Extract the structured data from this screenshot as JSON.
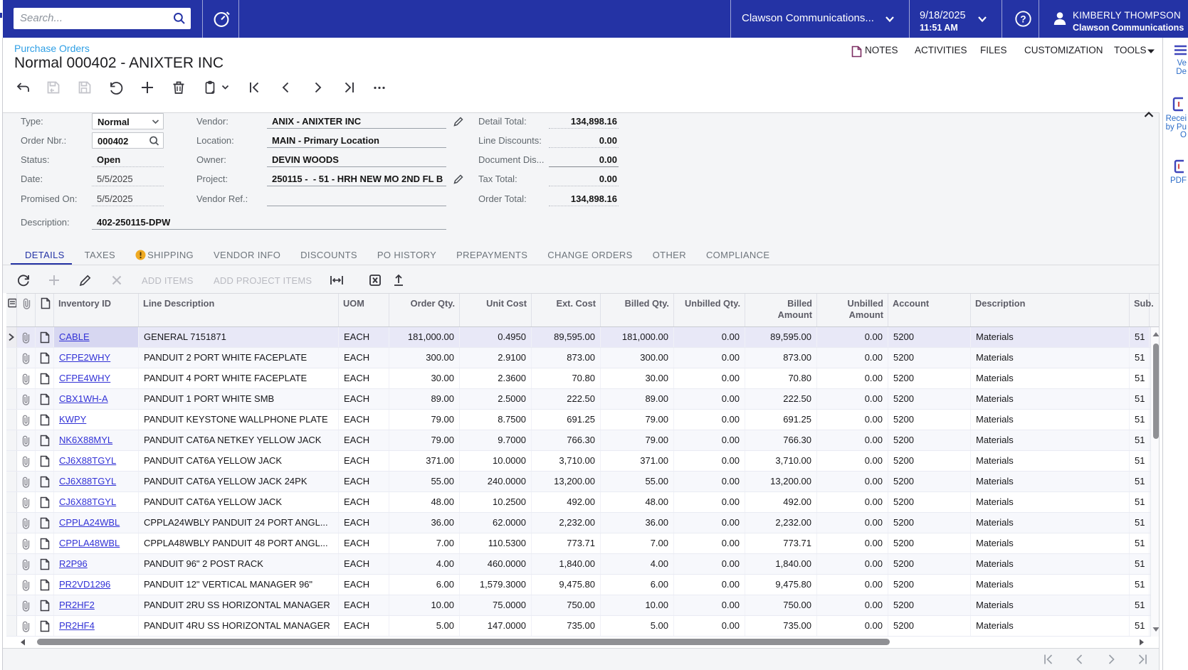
{
  "topbar": {
    "search_placeholder": "Search...",
    "company": "Clawson Communications...",
    "date": "9/18/2025",
    "time": "11:51 AM",
    "user_name": "KIMBERLY THOMPSON",
    "user_company": "Clawson Communications"
  },
  "header": {
    "breadcrumb": "Purchase Orders",
    "title": "Normal 000402 - ANIXTER INC",
    "menu": {
      "notes": "NOTES",
      "activities": "ACTIVITIES",
      "files": "FILES",
      "customization": "CUSTOMIZATION",
      "tools": "TOOLS"
    }
  },
  "form": {
    "type_label": "Type:",
    "type_value": "Normal",
    "order_nbr_label": "Order Nbr.:",
    "order_nbr_value": "000402",
    "status_label": "Status:",
    "status_value": "Open",
    "date_label": "Date:",
    "date_value": "5/5/2025",
    "promised_label": "Promised On:",
    "promised_value": "5/5/2025",
    "description_label": "Description:",
    "description_value": "402-250115-DPW",
    "vendor_label": "Vendor:",
    "vendor_value": "ANIX - ANIXTER INC",
    "location_label": "Location:",
    "location_value": "MAIN - Primary Location",
    "owner_label": "Owner:",
    "owner_value": "DEVIN WOODS",
    "project_label": "Project:",
    "project_value": "250115 -  - 51 - HRH NEW MO 2ND FL B",
    "vendor_ref_label": "Vendor Ref.:",
    "vendor_ref_value": "",
    "detail_total_label": "Detail Total:",
    "detail_total_value": "134,898.16",
    "line_discounts_label": "Line Discounts:",
    "line_discounts_value": "0.00",
    "document_discount_label": "Document Dis...",
    "document_discount_value": "0.00",
    "tax_total_label": "Tax Total:",
    "tax_total_value": "0.00",
    "order_total_label": "Order Total:",
    "order_total_value": "134,898.16"
  },
  "tabs": [
    {
      "label": "DETAILS",
      "active": true
    },
    {
      "label": "TAXES"
    },
    {
      "label": "SHIPPING",
      "warning": true
    },
    {
      "label": "VENDOR INFO"
    },
    {
      "label": "DISCOUNTS"
    },
    {
      "label": "PO HISTORY"
    },
    {
      "label": "PREPAYMENTS"
    },
    {
      "label": "CHANGE ORDERS"
    },
    {
      "label": "OTHER"
    },
    {
      "label": "COMPLIANCE"
    }
  ],
  "grid_toolbar": {
    "add_items": "ADD ITEMS",
    "add_project_items": "ADD PROJECT ITEMS"
  },
  "grid": {
    "columns": [
      "",
      "",
      "",
      "Inventory ID",
      "Line Description",
      "UOM",
      "Order Qty.",
      "Unit Cost",
      "Ext. Cost",
      "Billed Qty.",
      "Unbilled Qty.",
      "Billed Amount",
      "Unbilled Amount",
      "Account",
      "Description",
      "Sub."
    ],
    "rows": [
      {
        "inventory_id": "CABLE",
        "line_description": "GENERAL 7151871",
        "uom": "EACH",
        "order_qty": "181,000.00",
        "unit_cost": "0.4950",
        "ext_cost": "89,595.00",
        "billed_qty": "181,000.00",
        "unbilled_qty": "0.00",
        "billed_amount": "89,595.00",
        "unbilled_amount": "0.00",
        "account": "5200",
        "account_description": "Materials",
        "sub": "51"
      },
      {
        "inventory_id": "CFPE2WHY",
        "line_description": "PANDUIT 2 PORT WHITE FACEPLATE",
        "uom": "EACH",
        "order_qty": "300.00",
        "unit_cost": "2.9100",
        "ext_cost": "873.00",
        "billed_qty": "300.00",
        "unbilled_qty": "0.00",
        "billed_amount": "873.00",
        "unbilled_amount": "0.00",
        "account": "5200",
        "account_description": "Materials",
        "sub": "51"
      },
      {
        "inventory_id": "CFPE4WHY",
        "line_description": "PANDUIT 4 PORT WHITE FACEPLATE",
        "uom": "EACH",
        "order_qty": "30.00",
        "unit_cost": "2.3600",
        "ext_cost": "70.80",
        "billed_qty": "30.00",
        "unbilled_qty": "0.00",
        "billed_amount": "70.80",
        "unbilled_amount": "0.00",
        "account": "5200",
        "account_description": "Materials",
        "sub": "51"
      },
      {
        "inventory_id": "CBX1WH-A",
        "line_description": "PANDUIT 1 PORT WHITE SMB",
        "uom": "EACH",
        "order_qty": "89.00",
        "unit_cost": "2.5000",
        "ext_cost": "222.50",
        "billed_qty": "89.00",
        "unbilled_qty": "0.00",
        "billed_amount": "222.50",
        "unbilled_amount": "0.00",
        "account": "5200",
        "account_description": "Materials",
        "sub": "51"
      },
      {
        "inventory_id": "KWPY",
        "line_description": "PANDUIT KEYSTONE WALLPHONE PLATE",
        "uom": "EACH",
        "order_qty": "79.00",
        "unit_cost": "8.7500",
        "ext_cost": "691.25",
        "billed_qty": "79.00",
        "unbilled_qty": "0.00",
        "billed_amount": "691.25",
        "unbilled_amount": "0.00",
        "account": "5200",
        "account_description": "Materials",
        "sub": "51"
      },
      {
        "inventory_id": "NK6X88MYL",
        "line_description": "PANDUIT CAT6A NETKEY YELLOW JACK",
        "uom": "EACH",
        "order_qty": "79.00",
        "unit_cost": "9.7000",
        "ext_cost": "766.30",
        "billed_qty": "79.00",
        "unbilled_qty": "0.00",
        "billed_amount": "766.30",
        "unbilled_amount": "0.00",
        "account": "5200",
        "account_description": "Materials",
        "sub": "51"
      },
      {
        "inventory_id": "CJ6X88TGYL",
        "line_description": "PANDUIT CAT6A YELLOW JACK",
        "uom": "EACH",
        "order_qty": "371.00",
        "unit_cost": "10.0000",
        "ext_cost": "3,710.00",
        "billed_qty": "371.00",
        "unbilled_qty": "0.00",
        "billed_amount": "3,710.00",
        "unbilled_amount": "0.00",
        "account": "5200",
        "account_description": "Materials",
        "sub": "51"
      },
      {
        "inventory_id": "CJ6X88TGYL",
        "line_description": "PANDUIT CAT6A YELLOW JACK 24PK",
        "uom": "EACH",
        "order_qty": "55.00",
        "unit_cost": "240.0000",
        "ext_cost": "13,200.00",
        "billed_qty": "55.00",
        "unbilled_qty": "0.00",
        "billed_amount": "13,200.00",
        "unbilled_amount": "0.00",
        "account": "5200",
        "account_description": "Materials",
        "sub": "51"
      },
      {
        "inventory_id": "CJ6X88TGYL",
        "line_description": "PANDUIT CAT6A YELLOW JACK",
        "uom": "EACH",
        "order_qty": "48.00",
        "unit_cost": "10.2500",
        "ext_cost": "492.00",
        "billed_qty": "48.00",
        "unbilled_qty": "0.00",
        "billed_amount": "492.00",
        "unbilled_amount": "0.00",
        "account": "5200",
        "account_description": "Materials",
        "sub": "51"
      },
      {
        "inventory_id": "CPPLA24WBL",
        "line_description": "CPPLA24WBLY PANDUIT 24 PORT ANGL...",
        "uom": "EACH",
        "order_qty": "36.00",
        "unit_cost": "62.0000",
        "ext_cost": "2,232.00",
        "billed_qty": "36.00",
        "unbilled_qty": "0.00",
        "billed_amount": "2,232.00",
        "unbilled_amount": "0.00",
        "account": "5200",
        "account_description": "Materials",
        "sub": "51"
      },
      {
        "inventory_id": "CPPLA48WBL",
        "line_description": "CPPLA48WBLY PANDUIT 48 PORT ANGL...",
        "uom": "EACH",
        "order_qty": "7.00",
        "unit_cost": "110.5300",
        "ext_cost": "773.71",
        "billed_qty": "7.00",
        "unbilled_qty": "0.00",
        "billed_amount": "773.71",
        "unbilled_amount": "0.00",
        "account": "5200",
        "account_description": "Materials",
        "sub": "51"
      },
      {
        "inventory_id": "R2P96",
        "line_description": "PANDUIT 96\" 2 POST RACK",
        "uom": "EACH",
        "order_qty": "4.00",
        "unit_cost": "460.0000",
        "ext_cost": "1,840.00",
        "billed_qty": "4.00",
        "unbilled_qty": "0.00",
        "billed_amount": "1,840.00",
        "unbilled_amount": "0.00",
        "account": "5200",
        "account_description": "Materials",
        "sub": "51"
      },
      {
        "inventory_id": "PR2VD1296",
        "line_description": "PANDUIT 12\" VERTICAL MANAGER 96\"",
        "uom": "EACH",
        "order_qty": "6.00",
        "unit_cost": "1,579.3000",
        "ext_cost": "9,475.80",
        "billed_qty": "6.00",
        "unbilled_qty": "0.00",
        "billed_amount": "9,475.80",
        "unbilled_amount": "0.00",
        "account": "5200",
        "account_description": "Materials",
        "sub": "51"
      },
      {
        "inventory_id": "PR2HF2",
        "line_description": "PANDUIT 2RU SS HORIZONTAL MANAGER",
        "uom": "EACH",
        "order_qty": "10.00",
        "unit_cost": "75.0000",
        "ext_cost": "750.00",
        "billed_qty": "10.00",
        "unbilled_qty": "0.00",
        "billed_amount": "750.00",
        "unbilled_amount": "0.00",
        "account": "5200",
        "account_description": "Materials",
        "sub": "51"
      },
      {
        "inventory_id": "PR2HF4",
        "line_description": "PANDUIT 4RU SS HORIZONTAL MANAGER",
        "uom": "EACH",
        "order_qty": "5.00",
        "unit_cost": "147.0000",
        "ext_cost": "735.00",
        "billed_qty": "5.00",
        "unbilled_qty": "0.00",
        "billed_amount": "735.00",
        "unbilled_amount": "0.00",
        "account": "5200",
        "account_description": "Materials",
        "sub": "51"
      }
    ]
  },
  "side_panel": {
    "items": [
      {
        "lines": [
          "Ve",
          "De"
        ]
      },
      {
        "lines": [
          "Recei",
          "by Pu",
          "O"
        ]
      },
      {
        "lines": [
          "PDF"
        ]
      }
    ]
  },
  "colors": {
    "topbar": "#2433a5",
    "accent": "#2433a5",
    "breadcrumb_link": "#2e9fe5",
    "grid_link": "#3232d6",
    "warning": "#efaa23",
    "selected_row": "#e8e8f7"
  }
}
